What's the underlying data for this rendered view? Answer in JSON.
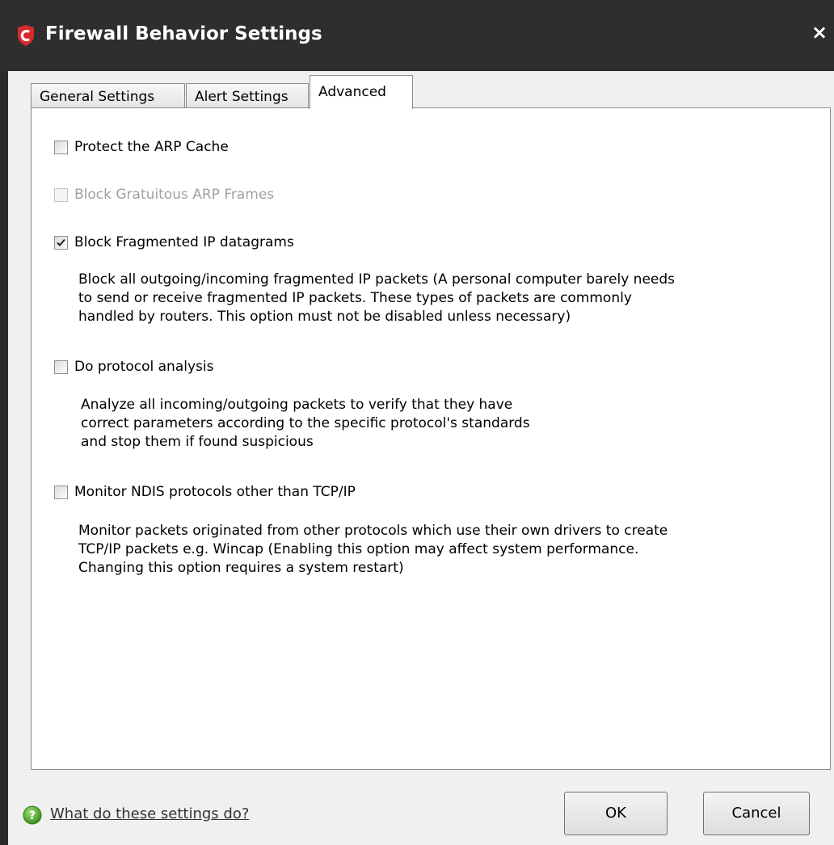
{
  "window": {
    "title": "Firewall Behavior Settings",
    "close_symbol": "×",
    "logo_icon": "comodo-logo-icon",
    "title_bar_color": "#2e2e2e",
    "logo_color": "#d62b2b"
  },
  "tabs": [
    {
      "label": "General Settings",
      "active": false
    },
    {
      "label": "Alert Settings",
      "active": false
    },
    {
      "label": "Advanced",
      "active": true
    }
  ],
  "options": [
    {
      "label": "Protect the ARP Cache",
      "checked": false,
      "enabled": true
    },
    {
      "label": "Block Gratuitous ARP Frames",
      "checked": false,
      "enabled": false
    },
    {
      "label": "Block Fragmented IP datagrams",
      "checked": true,
      "enabled": true,
      "description": "Block all outgoing/incoming fragmented IP packets (A personal computer barely needs\nto send or receive fragmented IP packets. These types of packets are commonly\nhandled by routers. This option must not be disabled unless necessary)"
    },
    {
      "label": "Do protocol analysis",
      "checked": false,
      "enabled": true,
      "description": "Analyze all incoming/outgoing packets to verify that they have\ncorrect parameters according to the specific protocol's standards\nand stop them if found suspicious"
    },
    {
      "label": "Monitor NDIS protocols other than TCP/IP",
      "checked": false,
      "enabled": true,
      "description": "Monitor packets originated from other protocols which use their own drivers to create\nTCP/IP packets e.g. Wincap (Enabling this option may affect system performance.\nChanging this option requires a system restart)"
    }
  ],
  "footer": {
    "help_icon": "help-question-icon",
    "help_link": "What do these settings do?",
    "ok_label": "OK",
    "cancel_label": "Cancel"
  }
}
